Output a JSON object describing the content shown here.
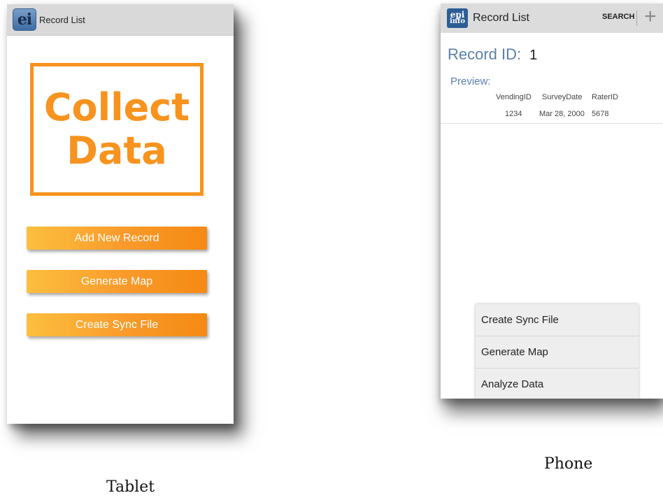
{
  "tablet": {
    "app_icon_label": "ei",
    "title": "Record List",
    "banner": {
      "line1": "Collect",
      "line2": "Data"
    },
    "buttons": [
      "Add New Record",
      "Generate Map",
      "Create Sync File"
    ],
    "caption": "Tablet"
  },
  "phone": {
    "app_icon": {
      "top": "epi",
      "bottom": "info"
    },
    "title": "Record List",
    "search_label": "SEARCH",
    "add_icon": "plus-icon",
    "record_id_label": "Record ID:",
    "record_id_value": "1",
    "preview_label": "Preview:",
    "preview": {
      "headers": [
        "VendingID",
        "SurveyDate",
        "RaterID"
      ],
      "values": [
        "1234",
        "Mar 28, 2000",
        "5678"
      ]
    },
    "menu_items": [
      "Create Sync File",
      "Generate Map",
      "Analyze Data"
    ],
    "caption": "Phone"
  },
  "colors": {
    "accent_orange": "#f7931e",
    "label_blue": "#5a7fae",
    "action_bar": "#dcdcdc"
  }
}
